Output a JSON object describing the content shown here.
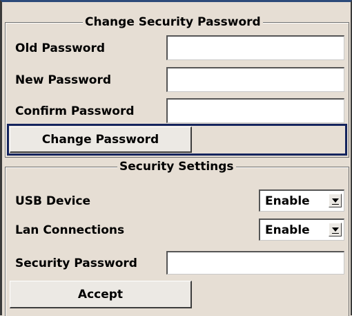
{
  "change_password_group": {
    "title": "Change Security Password",
    "old_password_label": "Old Password",
    "old_password_value": "",
    "new_password_label": "New Password",
    "new_password_value": "",
    "confirm_password_label": "Confirm Password",
    "confirm_password_value": "",
    "change_button_label": "Change Password"
  },
  "security_settings_group": {
    "title": "Security Settings",
    "usb_device_label": "USB Device",
    "usb_device_value": "Enable",
    "lan_connections_label": "Lan Connections",
    "lan_connections_value": "Enable",
    "security_password_label": "Security Password",
    "security_password_value": "",
    "accept_button_label": "Accept"
  },
  "colors": {
    "panel_background": "#e6ded4",
    "focus_border": "#14245e",
    "top_border": "#2c4a7a"
  },
  "icons": {
    "dropdown": "chevron-down-icon"
  }
}
